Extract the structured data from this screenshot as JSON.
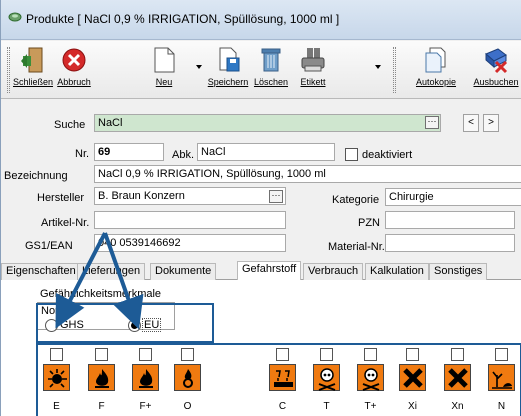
{
  "window": {
    "title": "Produkte [ NaCl 0,9 % IRRIGATION, Spüllösung, 1000 ml ]"
  },
  "toolbar": {
    "close_label": "Schließen",
    "abort_label": "Abbruch",
    "new_label": "Neu",
    "save_label": "Speichern",
    "delete_label": "Löschen",
    "label_label": "Etikett",
    "autocopy_label": "Autokopie",
    "book_label": "Ausbuchen"
  },
  "search": {
    "label": "Suche",
    "value": "NaCl",
    "prev": "<",
    "next": ">"
  },
  "form": {
    "nr_label": "Nr.",
    "nr_value": "69",
    "abk_label": "Abk.",
    "abk_value": "NaCl",
    "deactivated_label": "deaktiviert",
    "bezeichnung_label": "Bezeichnung",
    "bezeichnung_value": "NaCl 0,9 % IRRIGATION, Spüllösung, 1000 ml",
    "hersteller_label": "Hersteller",
    "hersteller_value": "B. Braun Konzern",
    "kategorie_label": "Kategorie",
    "kategorie_value": "Chirurgie",
    "artikelnr_label": "Artikel-Nr.",
    "artikelnr_value": "",
    "pzn_label": "PZN",
    "pzn_value": "",
    "gs1_label": "GS1/EAN",
    "gs1_value": "040 0539146692",
    "materialnr_label": "Material-Nr.",
    "materialnr_value": ""
  },
  "tabs": [
    "Eigenschaften",
    "Lieferungen",
    "Dokumente",
    "Gefahrstoff",
    "Verbrauch",
    "Kalkulation",
    "Sonstiges"
  ],
  "active_tab": "Gefahrstoff",
  "hazard": {
    "group_title": "Gefährlichkeitsmerkmale",
    "norm_label": "Norm",
    "ghs_label": "GHS",
    "eu_label": "EU",
    "selected_norm": "EU",
    "symbols": [
      {
        "code": "E",
        "icon": "explosive-icon",
        "checked": false
      },
      {
        "code": "F",
        "icon": "flame-icon",
        "checked": false
      },
      {
        "code": "F+",
        "icon": "flame-icon",
        "checked": false
      },
      {
        "code": "O",
        "icon": "oxidizing-icon",
        "checked": false
      },
      {
        "code": "C",
        "icon": "corrosive-icon",
        "checked": false
      },
      {
        "code": "T",
        "icon": "skull-icon",
        "checked": false
      },
      {
        "code": "T+",
        "icon": "skull-icon",
        "checked": false
      },
      {
        "code": "Xi",
        "icon": "cross-icon",
        "checked": false
      },
      {
        "code": "Xn",
        "icon": "cross-icon",
        "checked": false
      },
      {
        "code": "N",
        "icon": "environment-icon",
        "checked": false
      }
    ]
  },
  "colors": {
    "hazard_orange": "#f07a10",
    "annotation_blue": "#1d5b96",
    "search_green": "#cfe6cf"
  }
}
